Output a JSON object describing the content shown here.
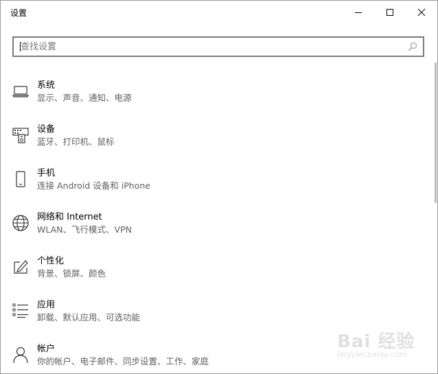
{
  "window": {
    "title": "设置",
    "controls": {
      "minimize": "minimize-icon",
      "maximize": "maximize-icon",
      "close": "close-icon"
    }
  },
  "search": {
    "placeholder": "查找设置",
    "value": "",
    "icon": "search-icon"
  },
  "items": [
    {
      "label": "系统",
      "desc": "显示、声音、通知、电源",
      "icon": "laptop-icon"
    },
    {
      "label": "设备",
      "desc": "蓝牙、打印机、鼠标",
      "icon": "devices-icon"
    },
    {
      "label": "手机",
      "desc": "连接 Android 设备和 iPhone",
      "icon": "phone-icon"
    },
    {
      "label": "网络和 Internet",
      "desc": "WLAN、飞行模式、VPN",
      "icon": "globe-icon"
    },
    {
      "label": "个性化",
      "desc": "背景、锁屏、颜色",
      "icon": "personalization-icon"
    },
    {
      "label": "应用",
      "desc": "卸载、默认应用、可选功能",
      "icon": "apps-list-icon"
    },
    {
      "label": "帐户",
      "desc": "你的帐户、电子邮件、同步设置、工作、家庭",
      "icon": "person-icon"
    }
  ],
  "watermark": {
    "brand": "Bai 经验",
    "url": "jingyan.baidu.com"
  },
  "colors": {
    "text_primary": "#000000",
    "text_secondary": "#5f5f5f",
    "search_border": "#7a7a7a",
    "window_border": "#9a9a9a"
  }
}
